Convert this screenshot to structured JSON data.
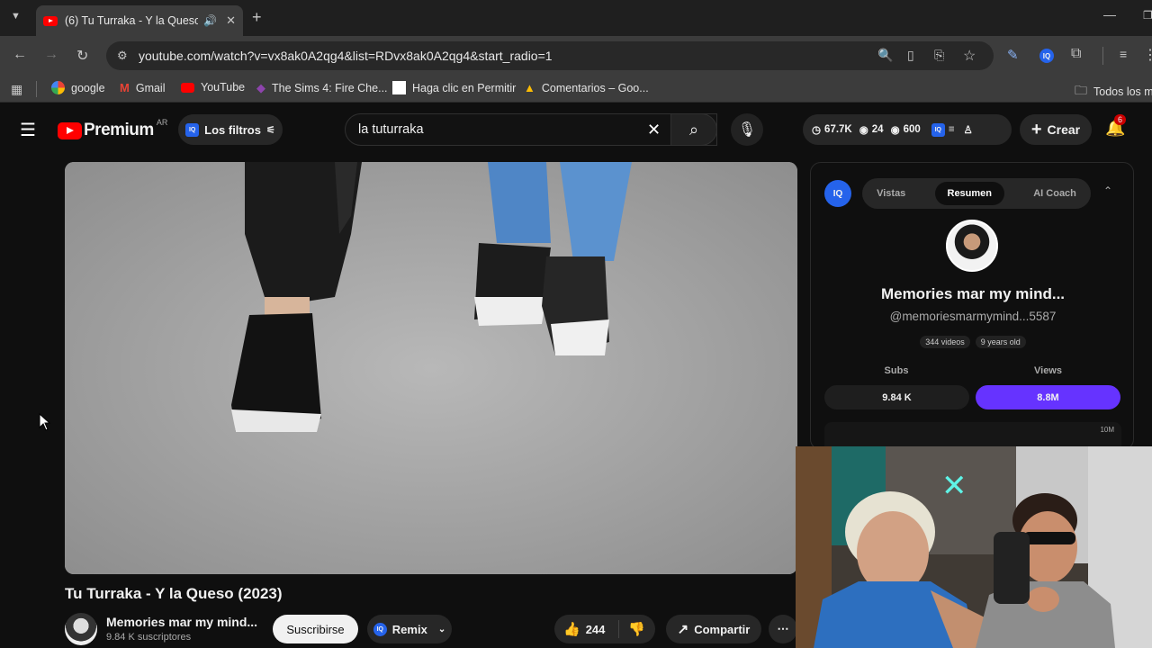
{
  "browser": {
    "tab_title": "(6) Tu Turraka - Y la Queso",
    "url": "youtube.com/watch?v=vx8ak0A2qg4&list=RDvx8ak0A2qg4&start_radio=1",
    "bookmarks": [
      {
        "label": "google"
      },
      {
        "label": "Gmail"
      },
      {
        "label": "YouTube"
      },
      {
        "label": "The Sims 4: Fire Che..."
      },
      {
        "label": "Haga clic en Permitir"
      },
      {
        "label": "Comentarios – Goo..."
      }
    ],
    "all_bookmarks": "Todos los m"
  },
  "youtube": {
    "logo_text": "Premium",
    "country": "AR",
    "filters_label": "Los filtros",
    "search_value": "la tuturraka",
    "stats": {
      "a": "67.7K",
      "b": "24",
      "c": "600"
    },
    "create_label": "Crear",
    "notif_count": "6"
  },
  "video": {
    "title": "Tu Turraka - Y la Queso (2023)",
    "channel": "Memories mar my mind...",
    "subscribers": "9.84 K suscriptores",
    "subscribe_label": "Suscribirse",
    "remix_label": "Remix",
    "likes": "244",
    "share_label": "Compartir"
  },
  "panel": {
    "tabs": [
      "Vistas",
      "Resumen",
      "AI Coach"
    ],
    "active_tab": 1,
    "channel_name": "Memories mar my mind...",
    "handle": "@memoriesmarmymind...5587",
    "videos": "344 videos",
    "age": "9 years old",
    "subs_label": "Subs",
    "views_label": "Views",
    "subs_value": "9.84 K",
    "views_value": "8.8M",
    "chart_top": "10M"
  },
  "colors": {
    "accent": "#6633ff",
    "iq_blue": "#2563eb",
    "yt_red": "#ff0000"
  }
}
